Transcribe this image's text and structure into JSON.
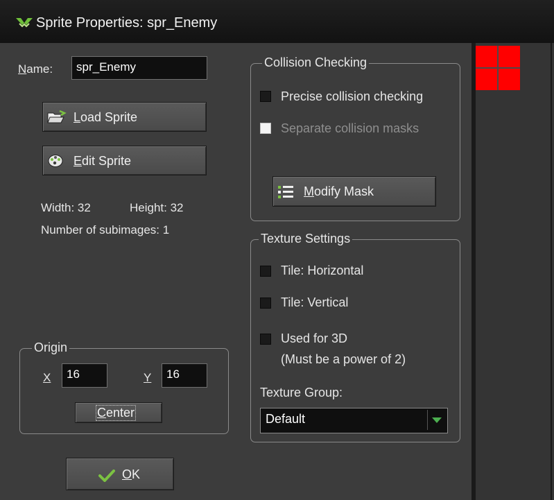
{
  "window": {
    "title": "Sprite Properties: spr_Enemy",
    "icon": "gamemaker-logo-icon"
  },
  "name_field": {
    "label_prefix": "N",
    "label_rest": "ame:",
    "value": "spr_Enemy"
  },
  "buttons": {
    "load_sprite": {
      "accel": "L",
      "rest": "oad Sprite",
      "icon": "folder-open-icon"
    },
    "edit_sprite": {
      "accel": "E",
      "rest": "dit Sprite",
      "icon": "palette-icon"
    },
    "modify_mask": {
      "accel": "M",
      "rest": "odify Mask",
      "icon": "checklist-icon"
    },
    "center": {
      "accel": "C",
      "rest": "enter"
    },
    "ok": {
      "accel": "O",
      "rest": "K",
      "icon": "checkmark-icon"
    }
  },
  "info": {
    "width": "Width: 32",
    "height": "Height: 32",
    "subimages": "Number of subimages: 1"
  },
  "origin": {
    "title": "Origin",
    "x_label": "X",
    "x_value": "16",
    "y_label": "Y",
    "y_value": "16"
  },
  "collision": {
    "title": "Collision Checking",
    "precise": {
      "accel": "P",
      "rest": "recise collision checking",
      "checked": false
    },
    "separate": {
      "pre": "Separat",
      "accel": "e",
      "rest": " collision masks",
      "checked": false,
      "enabled": false
    }
  },
  "texture": {
    "title": "Texture Settings",
    "tile_horizontal": "Tile: Horizontal",
    "tile_vertical": "Tile: Vertical",
    "used_for_3d": "Used for 3D",
    "used_for_3d_note": "(Must be a power of 2)",
    "group_label": "Texture Group:",
    "group_value": "Default"
  },
  "colors": {
    "background": "#3c3c3c",
    "titlebar": "#161616",
    "sprite_red": "#ff0000",
    "dropdown_arrow": "#4caf50",
    "ok_check": "#7cc242"
  }
}
